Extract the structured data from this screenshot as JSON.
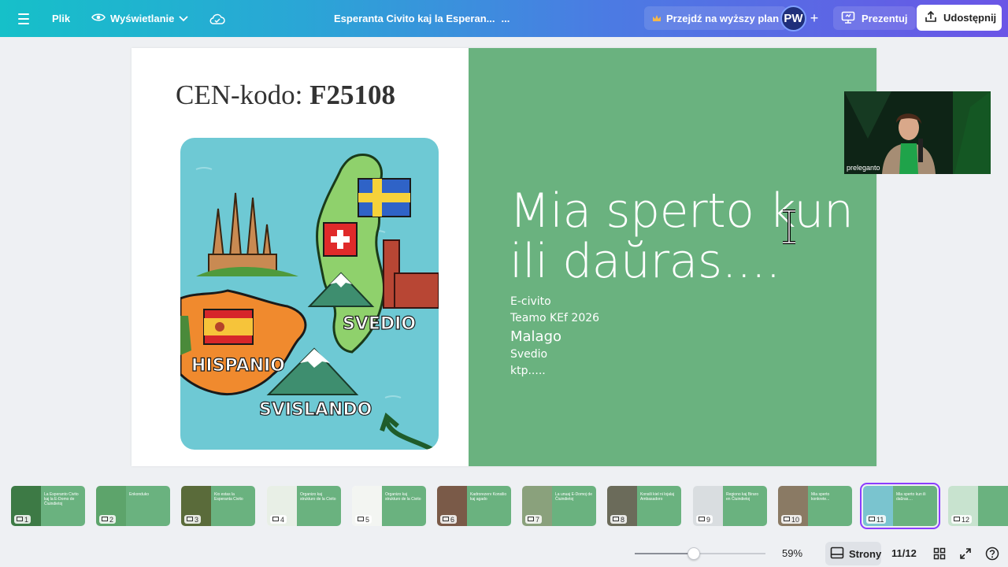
{
  "topbar": {
    "file_label": "Plik",
    "view_label": "Wyświetlanie",
    "doc_title": "Esperanta Civito kaj la Esperan...",
    "doc_title_more": "...",
    "upgrade_label": "Przejdź na wyższy plan",
    "avatar_initials": "PW",
    "plus_label": "+",
    "present_label": "Prezentuj",
    "share_label": "Udostępnij"
  },
  "slide": {
    "cen_label": "CEN-kodo:",
    "cen_code": "F25108",
    "map_labels": {
      "sweden": "SVEDIO",
      "spain": "HISPANIO",
      "switzerland": "SVISLANDO"
    },
    "title_line1": "Mia sperto kun",
    "title_line2": "ili daŭras....",
    "subtitle_lines": [
      "E-civito",
      "Teamo KEf 2026",
      "Malago",
      "Svedio",
      "ktp....."
    ],
    "colors": {
      "green": "#6ab27f",
      "sea": "#6ec9d4"
    }
  },
  "webcam": {
    "label": "preleganto"
  },
  "thumbnails": [
    {
      "num": "1",
      "text": "La Esperanto Civito kaj la E-Domo de Ĉiuindietoj",
      "left_color": "#3d7a45"
    },
    {
      "num": "2",
      "text": "Enkonduko",
      "left_color": "#5da46b"
    },
    {
      "num": "3",
      "text": "Kio estas la Esperanta Civito",
      "left_color": "#5a6b3a"
    },
    {
      "num": "4",
      "text": "Organizo kaj strukturo de la Civito",
      "left_color": "#e8efe6"
    },
    {
      "num": "5",
      "text": "Organizo kaj strukturo de la Civito",
      "left_color": "#f3f5f2"
    },
    {
      "num": "6",
      "text": "Kadrorezerv Konsilio kaj agado",
      "left_color": "#7a5a48"
    },
    {
      "num": "7",
      "text": "La unuaj E-Domoj de Ĉiuindietoj",
      "left_color": "#8aa17c"
    },
    {
      "num": "8",
      "text": "Konsili kiel ni lojalaj Ambasadoro",
      "left_color": "#6b6b5a"
    },
    {
      "num": "9",
      "text": "Regiono kaj Biraro en Ĉiuindietoj",
      "left_color": "#d9dde0"
    },
    {
      "num": "10",
      "text": "Mia sperto konkrete...",
      "left_color": "#8a7a64"
    },
    {
      "num": "11",
      "text": "Mia sperto kun ili daŭras....",
      "left_color": "#7ac4cf",
      "active": true
    },
    {
      "num": "12",
      "text": "",
      "left_color": "#c8e3cf"
    }
  ],
  "bottombar": {
    "zoom_fraction": 0.45,
    "zoom_label": "59%",
    "pages_label": "Strony",
    "page_count": "11/12"
  }
}
